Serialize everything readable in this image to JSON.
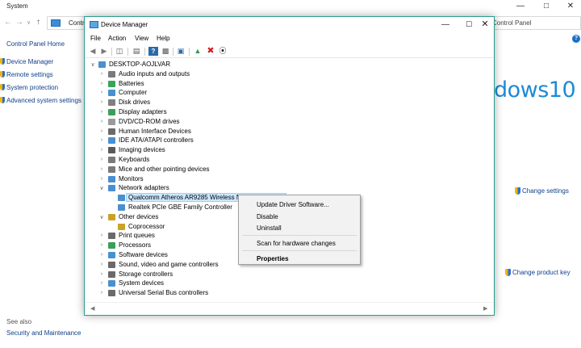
{
  "system_window": {
    "title": "System",
    "address_crumb": "Contro",
    "search_text": "Control Panel",
    "left_nav": {
      "home": "Control Panel Home",
      "links": [
        "Device Manager",
        "Remote settings",
        "System protection",
        "Advanced system settings"
      ]
    },
    "see_also_label": "See also",
    "see_also_link": "Security and Maintenance",
    "windows_logo_text": "dows10",
    "change_settings": "Change settings",
    "change_product_key": "Change product key"
  },
  "device_manager": {
    "title": "Device Manager",
    "menu": [
      "File",
      "Action",
      "View",
      "Help"
    ],
    "tree": [
      {
        "label": "DESKTOP-AOJLVAR",
        "level": 0,
        "state": "expanded",
        "icon": "computer-icon",
        "color": "#4a8fd0"
      },
      {
        "label": "Audio inputs and outputs",
        "level": 1,
        "state": "collapsed",
        "icon": "speaker-icon",
        "color": "#7a7a7a"
      },
      {
        "label": "Batteries",
        "level": 1,
        "state": "collapsed",
        "icon": "battery-icon",
        "color": "#3aa35a"
      },
      {
        "label": "Computer",
        "level": 1,
        "state": "collapsed",
        "icon": "monitor-icon",
        "color": "#4a8fd0"
      },
      {
        "label": "Disk drives",
        "level": 1,
        "state": "collapsed",
        "icon": "disk-icon",
        "color": "#808080"
      },
      {
        "label": "Display adapters",
        "level": 1,
        "state": "collapsed",
        "icon": "display-adapter-icon",
        "color": "#3b9f5b"
      },
      {
        "label": "DVD/CD-ROM drives",
        "level": 1,
        "state": "collapsed",
        "icon": "dvd-icon",
        "color": "#9a9a9a"
      },
      {
        "label": "Human Interface Devices",
        "level": 1,
        "state": "collapsed",
        "icon": "hid-icon",
        "color": "#6a6a6a"
      },
      {
        "label": "IDE ATA/ATAPI controllers",
        "level": 1,
        "state": "collapsed",
        "icon": "controller-icon",
        "color": "#4a8fd0"
      },
      {
        "label": "Imaging devices",
        "level": 1,
        "state": "collapsed",
        "icon": "camera-icon",
        "color": "#5a5a5a"
      },
      {
        "label": "Keyboards",
        "level": 1,
        "state": "collapsed",
        "icon": "keyboard-icon",
        "color": "#7a7a7a"
      },
      {
        "label": "Mice and other pointing devices",
        "level": 1,
        "state": "collapsed",
        "icon": "mouse-icon",
        "color": "#7a7a7a"
      },
      {
        "label": "Monitors",
        "level": 1,
        "state": "collapsed",
        "icon": "monitor-icon",
        "color": "#4a8fd0"
      },
      {
        "label": "Network adapters",
        "level": 1,
        "state": "expanded",
        "icon": "network-icon",
        "color": "#4a8fd0"
      },
      {
        "label": "Qualcomm Atheros AR9285 Wireless Network Adapter",
        "level": 2,
        "state": "leaf",
        "icon": "network-icon",
        "color": "#4a8fd0",
        "selected": true
      },
      {
        "label": "Realtek PCIe GBE Family Controller",
        "level": 2,
        "state": "leaf",
        "icon": "network-icon",
        "color": "#4a8fd0"
      },
      {
        "label": "Other devices",
        "level": 1,
        "state": "expanded",
        "icon": "warning-icon",
        "color": "#c9a227"
      },
      {
        "label": "Coprocessor",
        "level": 2,
        "state": "leaf",
        "icon": "warning-icon",
        "color": "#c9a227"
      },
      {
        "label": "Print queues",
        "level": 1,
        "state": "collapsed",
        "icon": "printer-icon",
        "color": "#6a6a6a"
      },
      {
        "label": "Processors",
        "level": 1,
        "state": "collapsed",
        "icon": "cpu-icon",
        "color": "#3b9f5b"
      },
      {
        "label": "Software devices",
        "level": 1,
        "state": "collapsed",
        "icon": "software-icon",
        "color": "#4a8fd0"
      },
      {
        "label": "Sound, video and game controllers",
        "level": 1,
        "state": "collapsed",
        "icon": "sound-icon",
        "color": "#6a6a6a"
      },
      {
        "label": "Storage controllers",
        "level": 1,
        "state": "collapsed",
        "icon": "storage-icon",
        "color": "#6a6a6a"
      },
      {
        "label": "System devices",
        "level": 1,
        "state": "collapsed",
        "icon": "system-icon",
        "color": "#4a8fd0"
      },
      {
        "label": "Universal Serial Bus controllers",
        "level": 1,
        "state": "collapsed",
        "icon": "usb-icon",
        "color": "#6a6a6a"
      }
    ]
  },
  "context_menu": {
    "items": [
      "Update Driver Software...",
      "Disable",
      "Uninstall",
      "Scan for hardware changes",
      "Properties"
    ]
  },
  "colors": {
    "accent": "#0f3f8a",
    "window_border": "#2a9d8f",
    "selection": "#cce8ff",
    "win10_blue": "#1d8ad6"
  }
}
